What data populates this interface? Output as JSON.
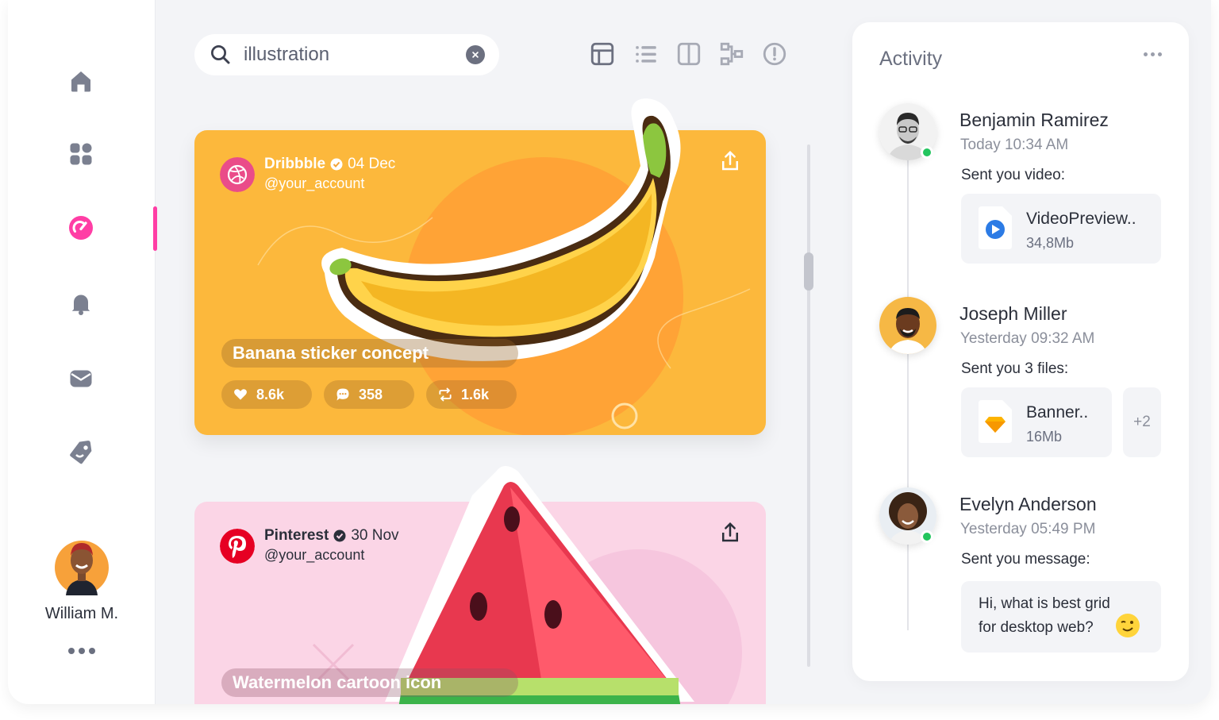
{
  "sidebar": {
    "items": [
      {
        "name": "home",
        "active": false
      },
      {
        "name": "apps-grid",
        "active": false
      },
      {
        "name": "dashboard",
        "active": true
      },
      {
        "name": "notifications",
        "active": false
      },
      {
        "name": "mail",
        "active": false
      },
      {
        "name": "tag",
        "active": false
      }
    ],
    "accent_color": "#ff3ea5",
    "user": {
      "name": "William M."
    }
  },
  "search": {
    "value": "illustration",
    "placeholder": "Search"
  },
  "toolbar": {
    "views": [
      "grid-view",
      "list-view",
      "split-view",
      "hierarchy-view",
      "info"
    ]
  },
  "feed": {
    "cards": [
      {
        "source": "Dribbble",
        "date": "04 Dec",
        "account": "@your_account",
        "title": "Banana sticker concept",
        "likes": "8.6k",
        "comments": "358",
        "reposts": "1.6k",
        "background": "#fcb83c"
      },
      {
        "source": "Pinterest",
        "date": "30 Nov",
        "account": "@your_account",
        "title": "Watermelon cartoon icon",
        "background": "#fbd5e6"
      }
    ]
  },
  "activity": {
    "title": "Activity",
    "items": [
      {
        "name": "Benjamin Ramirez",
        "time": "Today 10:34 AM",
        "message": "Sent you video:",
        "file": {
          "name": "VideoPreview..",
          "size": "34,8Mb",
          "icon": "video-file-icon"
        },
        "online": true
      },
      {
        "name": "Joseph Miller",
        "time": "Yesterday 09:32 AM",
        "message": "Sent you 3 files:",
        "file": {
          "name": "Banner..",
          "size": "16Mb",
          "icon": "sketch-file-icon"
        },
        "more_files": "+2",
        "online": false
      },
      {
        "name": "Evelyn Anderson",
        "time": "Yesterday 05:49 PM",
        "message": "Sent you message:",
        "chat": {
          "line1": "Hi, what is best grid",
          "line2": "for desktop web?"
        },
        "online": true
      }
    ]
  }
}
